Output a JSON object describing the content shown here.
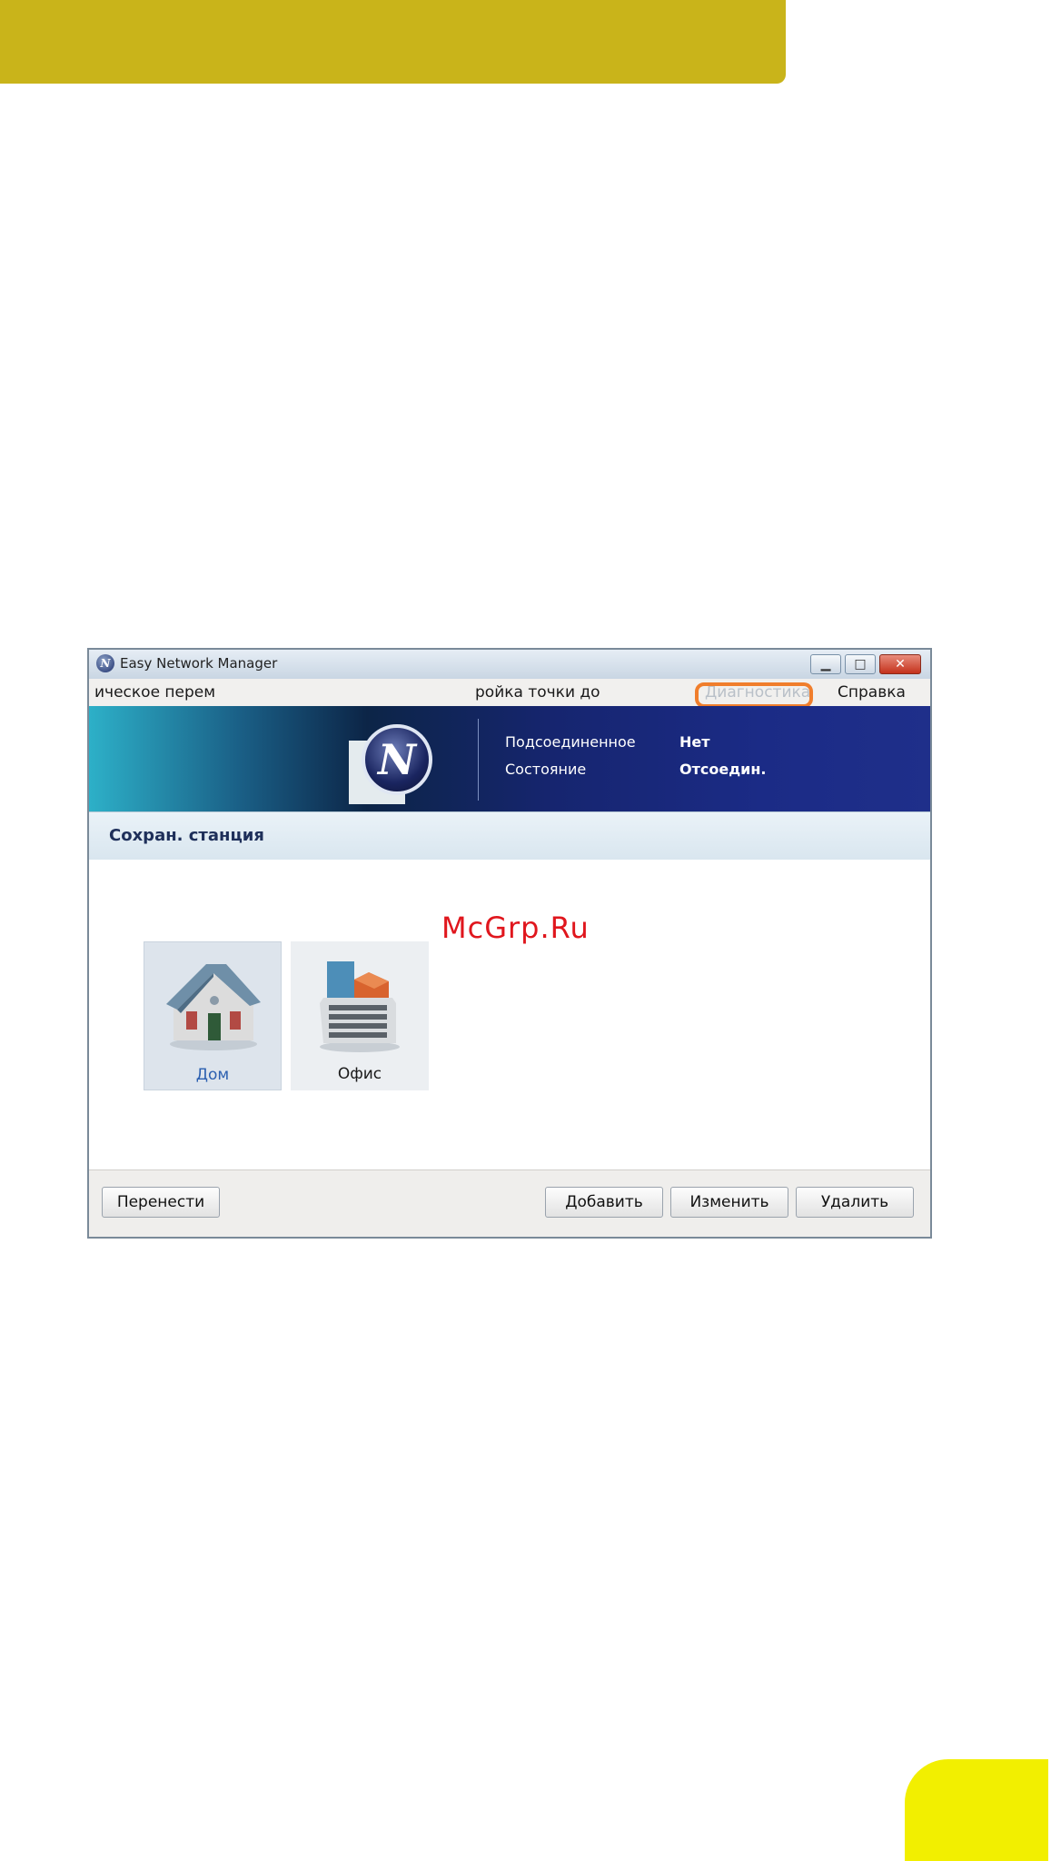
{
  "window": {
    "title": "Easy Network Manager"
  },
  "menu": {
    "items": [
      "ическое перем",
      "ройка точки до",
      "Диагностика",
      "Справка"
    ],
    "highlighted": "Диагностика"
  },
  "header": {
    "logo_letter": "N",
    "connected_label": "Подсоединенное",
    "connected_value": "Нет",
    "status_label": "Состояние",
    "status_value": "Отсоедин."
  },
  "section": {
    "title": "Сохран. станция"
  },
  "stations": [
    {
      "label": "Дом",
      "icon": "house-icon",
      "selected": true
    },
    {
      "label": "Офис",
      "icon": "office-building-icon",
      "selected": false
    }
  ],
  "watermark": "McGrp.Ru",
  "buttons": {
    "move": "Перенести",
    "add": "Добавить",
    "edit": "Изменить",
    "delete": "Удалить"
  },
  "colors": {
    "banner": "#c9b41a",
    "highlight": "#f07e2c",
    "page_tab": "#f2ef00",
    "watermark": "#e0161d"
  }
}
